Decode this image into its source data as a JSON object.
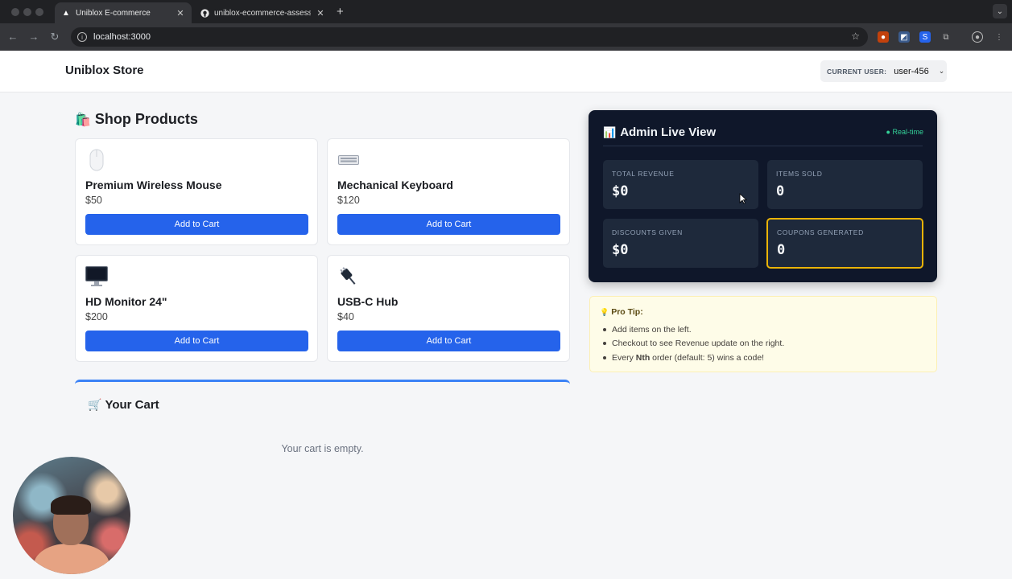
{
  "browser": {
    "tabs": [
      {
        "title": "Uniblox E-commerce",
        "icon": "triangle-icon",
        "active": true
      },
      {
        "title": "uniblox-ecommerce-assessm",
        "icon": "github-icon",
        "active": false
      }
    ],
    "url": "localhost:3000"
  },
  "header": {
    "brand": "Uniblox Store",
    "user_label": "CURRENT USER:",
    "user_value": "user-456"
  },
  "shop": {
    "title": "Shop Products",
    "title_emoji": "🛍️",
    "products": [
      {
        "name": "Premium Wireless Mouse",
        "price": "$50",
        "emoji": "🖱️",
        "button": "Add to Cart"
      },
      {
        "name": "Mechanical Keyboard",
        "price": "$120",
        "emoji": "⌨️",
        "button": "Add to Cart"
      },
      {
        "name": "HD Monitor 24\"",
        "price": "$200",
        "emoji": "🖥️",
        "button": "Add to Cart"
      },
      {
        "name": "USB-C Hub",
        "price": "$40",
        "emoji": "🔌",
        "button": "Add to Cart"
      }
    ]
  },
  "cart": {
    "title": "Your Cart",
    "title_emoji": "🛒",
    "empty_text": "Your cart is empty."
  },
  "admin": {
    "title": "Admin Live View",
    "title_emoji": "📊",
    "status": "● Real-time",
    "stats": [
      {
        "label": "TOTAL REVENUE",
        "value": "$0"
      },
      {
        "label": "ITEMS SOLD",
        "value": "0"
      },
      {
        "label": "DISCOUNTS GIVEN",
        "value": "$0"
      },
      {
        "label": "COUPONS GENERATED",
        "value": "0"
      }
    ]
  },
  "tip": {
    "title": "Pro Tip:",
    "title_emoji": "💡",
    "items": [
      "Add items on the left.",
      "Checkout to see Revenue update on the right."
    ],
    "item3_pre": "Every ",
    "item3_bold": "Nth",
    "item3_post": " order (default: 5) wins a code!"
  },
  "colors": {
    "primary": "#2563eb",
    "admin_bg": "#0f172a",
    "stat_bg": "#1e293b",
    "highlight": "#eab308",
    "live": "#34d399",
    "tip_bg": "#fefce8"
  }
}
